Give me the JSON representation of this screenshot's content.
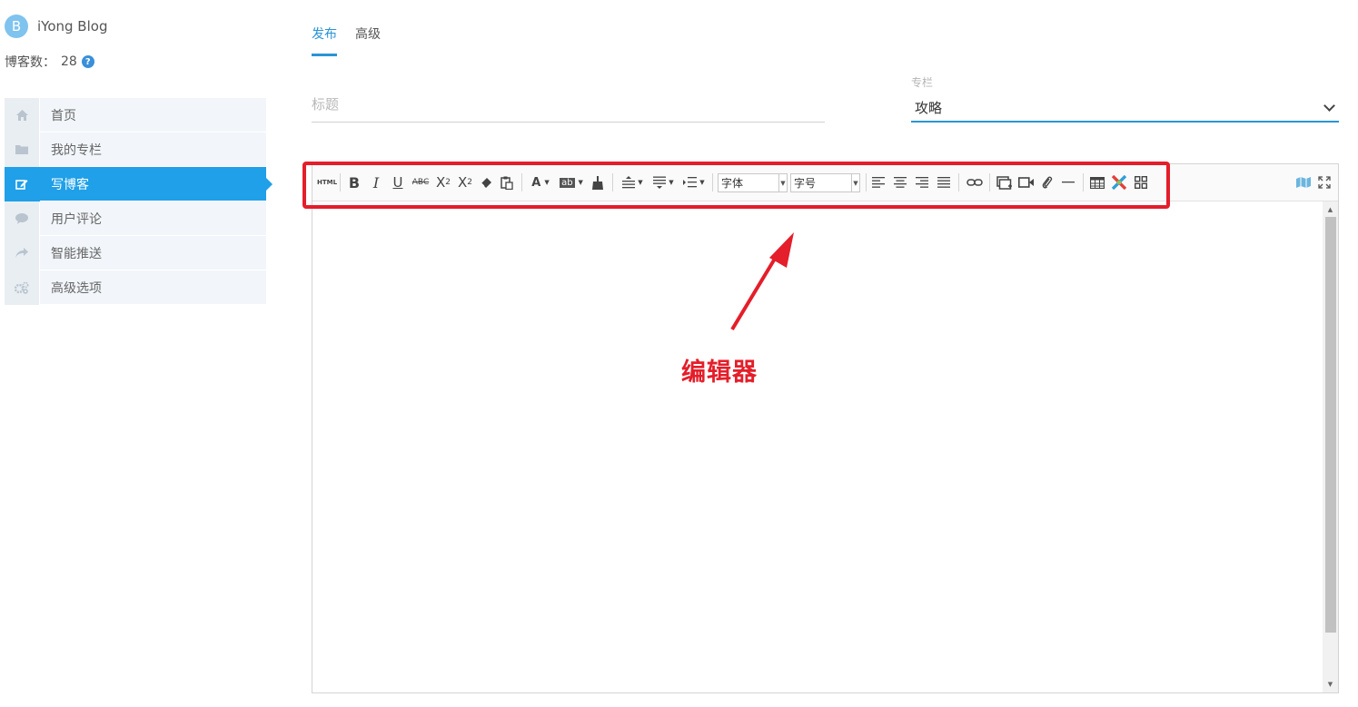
{
  "brand": {
    "avatar_letter": "B",
    "name": "iYong Blog"
  },
  "stats": {
    "label": "博客数：",
    "value": "28",
    "help_glyph": "?"
  },
  "sidebar": {
    "items": [
      {
        "label": "首页",
        "icon": "home-icon",
        "active": false
      },
      {
        "label": "我的专栏",
        "icon": "folder-icon",
        "active": false
      },
      {
        "label": "写博客",
        "icon": "edit-icon",
        "active": true
      },
      {
        "label": "用户评论",
        "icon": "comment-icon",
        "active": false
      },
      {
        "label": "智能推送",
        "icon": "share-icon",
        "active": false
      },
      {
        "label": "高级选项",
        "icon": "gears-icon",
        "active": false
      }
    ]
  },
  "tabs": [
    {
      "label": "发布",
      "active": true
    },
    {
      "label": "高级",
      "active": false
    }
  ],
  "form": {
    "title_placeholder": "标题",
    "column_label": "专栏",
    "column_value": "攻略"
  },
  "editor": {
    "toolbar": {
      "html_label": "HTML",
      "bold": "B",
      "italic": "I",
      "underline": "U",
      "strike": "ABC",
      "superscript": "X",
      "superscript_mark": "2",
      "subscript": "X",
      "subscript_mark": "2",
      "font_color": "A",
      "bg_color": "ab",
      "font_family": "字体",
      "font_size": "字号"
    }
  },
  "annotation": {
    "label": "编辑器",
    "color": "#e41e2a"
  },
  "colors": {
    "accent": "#2a94d6",
    "active_menu": "#1fa0e8"
  }
}
